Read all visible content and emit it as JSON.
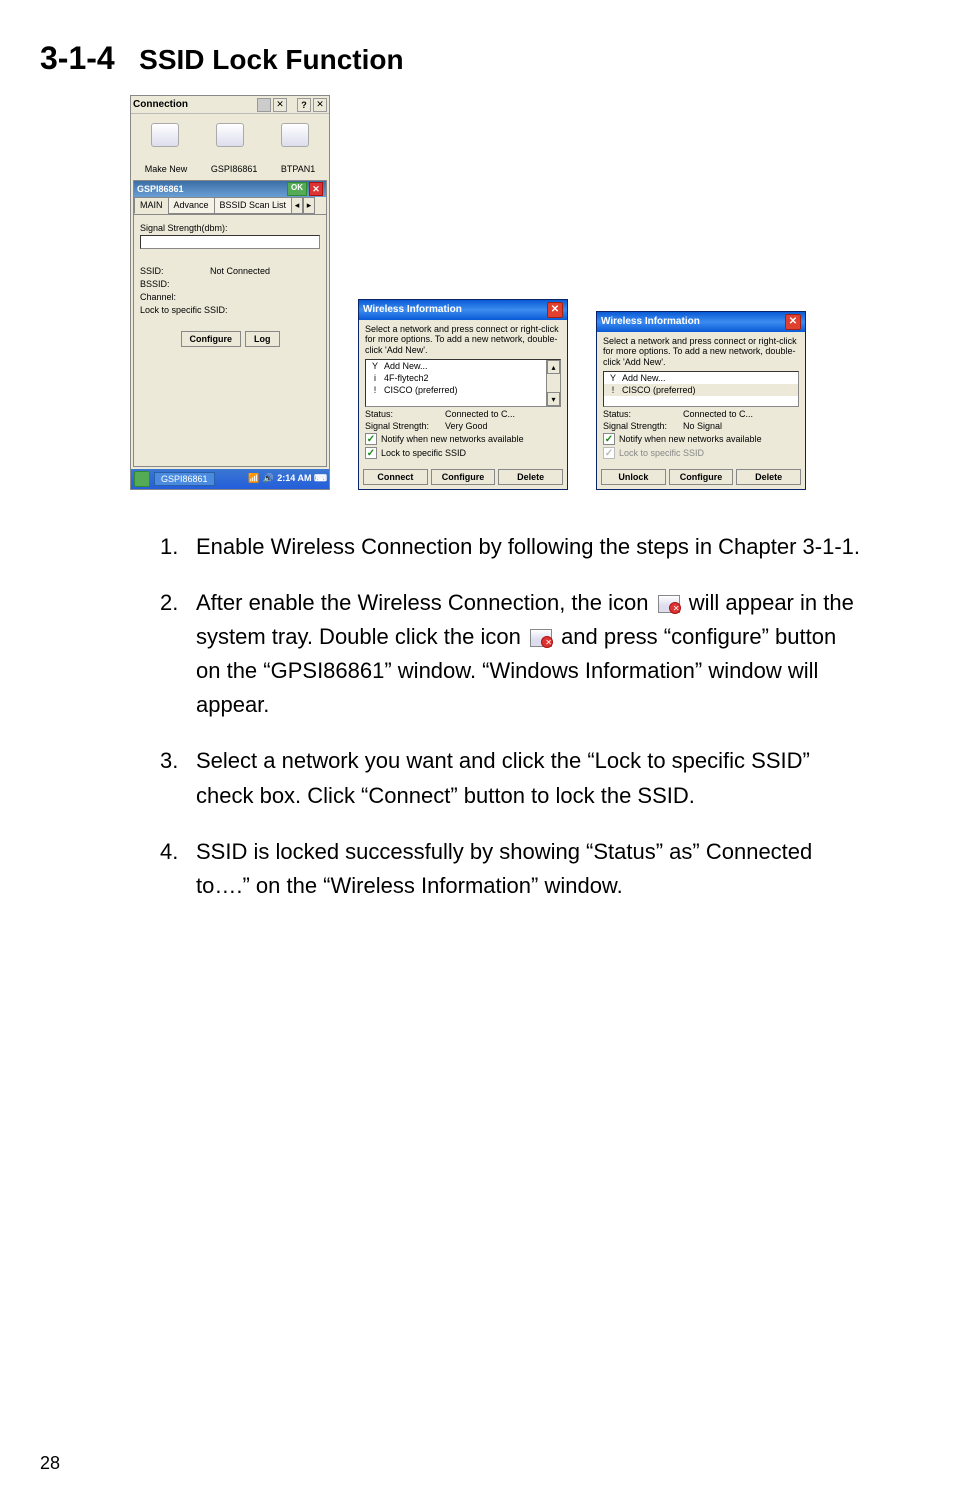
{
  "page_number": "28",
  "heading": {
    "number": "3-1-4",
    "title": "SSID Lock Function"
  },
  "screenshot1": {
    "connection_title": "Connection",
    "icons": {
      "make_new": "Make New",
      "gspi": "GSPI86861",
      "btpan": "BTPAN1"
    },
    "sub_title": "GSPI86861",
    "ok_label": "OK",
    "tabs": {
      "main": "MAIN",
      "advance": "Advance",
      "bssid": "BSSID Scan List"
    },
    "signal_label": "Signal Strength(dbm):",
    "fields": {
      "ssid_label": "SSID:",
      "ssid_value": "Not Connected",
      "bssid_label": "BSSID:",
      "bssid_value": "",
      "channel_label": "Channel:",
      "channel_value": "",
      "lock_label": "Lock to specific SSID:",
      "lock_value": ""
    },
    "buttons": {
      "configure": "Configure",
      "log": "Log"
    },
    "taskbar": {
      "app": "GSPI86861",
      "time": "2:14 AM"
    }
  },
  "screenshot2": {
    "title": "Wireless Information",
    "instruction": "Select a network and press connect or right-click for more options.  To add a new network, double-click 'Add New'.",
    "list": [
      {
        "icon": "Y",
        "label": "Add New..."
      },
      {
        "icon": "i",
        "label": "4F-flytech2"
      },
      {
        "icon": "!",
        "label": "CISCO (preferred)"
      }
    ],
    "status_label": "Status:",
    "status_value": "Connected to C...",
    "signal_label": "Signal Strength:",
    "signal_value": "Very Good",
    "notify_label": "Notify when new networks available",
    "lock_label": "Lock to specific SSID",
    "buttons": {
      "connect": "Connect",
      "configure": "Configure",
      "delete": "Delete"
    }
  },
  "screenshot3": {
    "title": "Wireless Information",
    "instruction": "Select a network and press connect or right-click for more options.  To add a new network, double-click 'Add New'.",
    "list": [
      {
        "icon": "Y",
        "label": "Add New..."
      },
      {
        "icon": "!",
        "label": "CISCO (preferred)"
      }
    ],
    "status_label": "Status:",
    "status_value": "Connected to C...",
    "signal_label": "Signal Strength:",
    "signal_value": "No Signal",
    "notify_label": "Notify when new networks available",
    "lock_label": "Lock to specific SSID",
    "buttons": {
      "unlock": "Unlock",
      "configure": "Configure",
      "delete": "Delete"
    }
  },
  "instructions": {
    "item1": {
      "num": "1.",
      "text": "Enable Wireless Connection by following the steps in Chapter 3-1-1."
    },
    "item2": {
      "num": "2.",
      "text_a": "After enable the Wireless Connection, the icon ",
      "text_b": " will appear in the system tray. Double click the icon ",
      "text_c": " and press “configure” button on the “GPSI86861” window. “Windows Information” window will appear."
    },
    "item3": {
      "num": "3.",
      "text": "Select a network you want and click the “Lock to specific SSID” check box. Click “Connect” button to lock the SSID."
    },
    "item4": {
      "num": "4.",
      "text": "SSID is locked successfully by showing “Status” as” Connected to….” on the “Wireless Information” window."
    }
  }
}
